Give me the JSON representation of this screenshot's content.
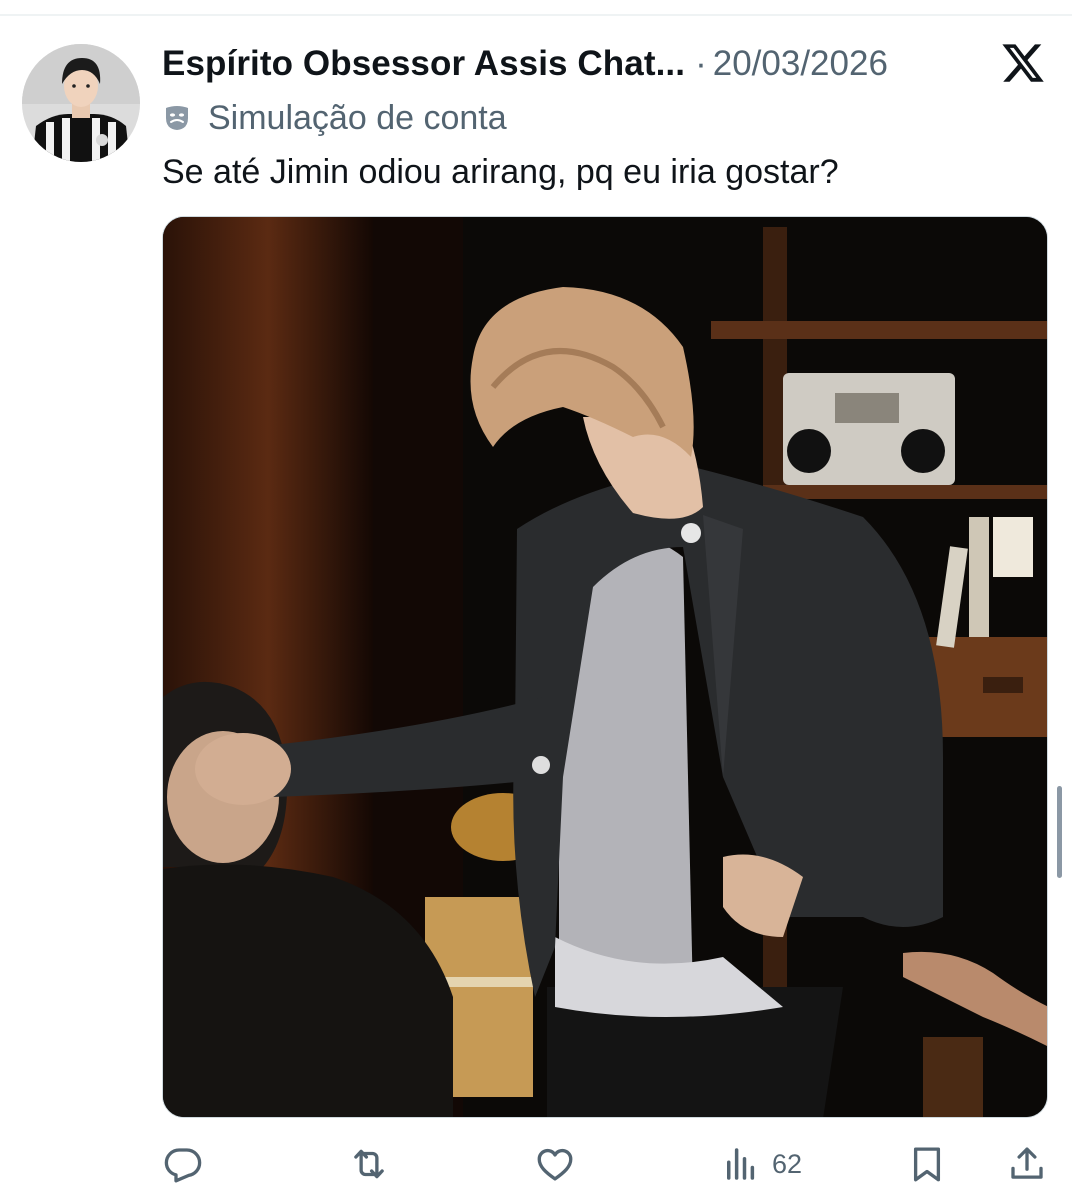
{
  "tweet": {
    "display_name": "Espírito Obsessor Assis Chat...",
    "separator": "·",
    "date": "20/03/2026",
    "badge_text": "Simulação de conta",
    "text": "Se até Jimin odiou arirang, pq eu iria gostar?"
  },
  "icons": {
    "x_logo": "x-logo-icon",
    "badge": "theater-mask-icon",
    "reply": "reply-icon",
    "repost": "repost-icon",
    "like": "heart-icon",
    "views": "views-icon",
    "bookmark": "bookmark-icon",
    "share": "share-icon"
  },
  "actions": {
    "views_count": "62"
  },
  "colors": {
    "text_primary": "#0f1419",
    "text_secondary": "#536471",
    "divider": "#eff3f4"
  }
}
